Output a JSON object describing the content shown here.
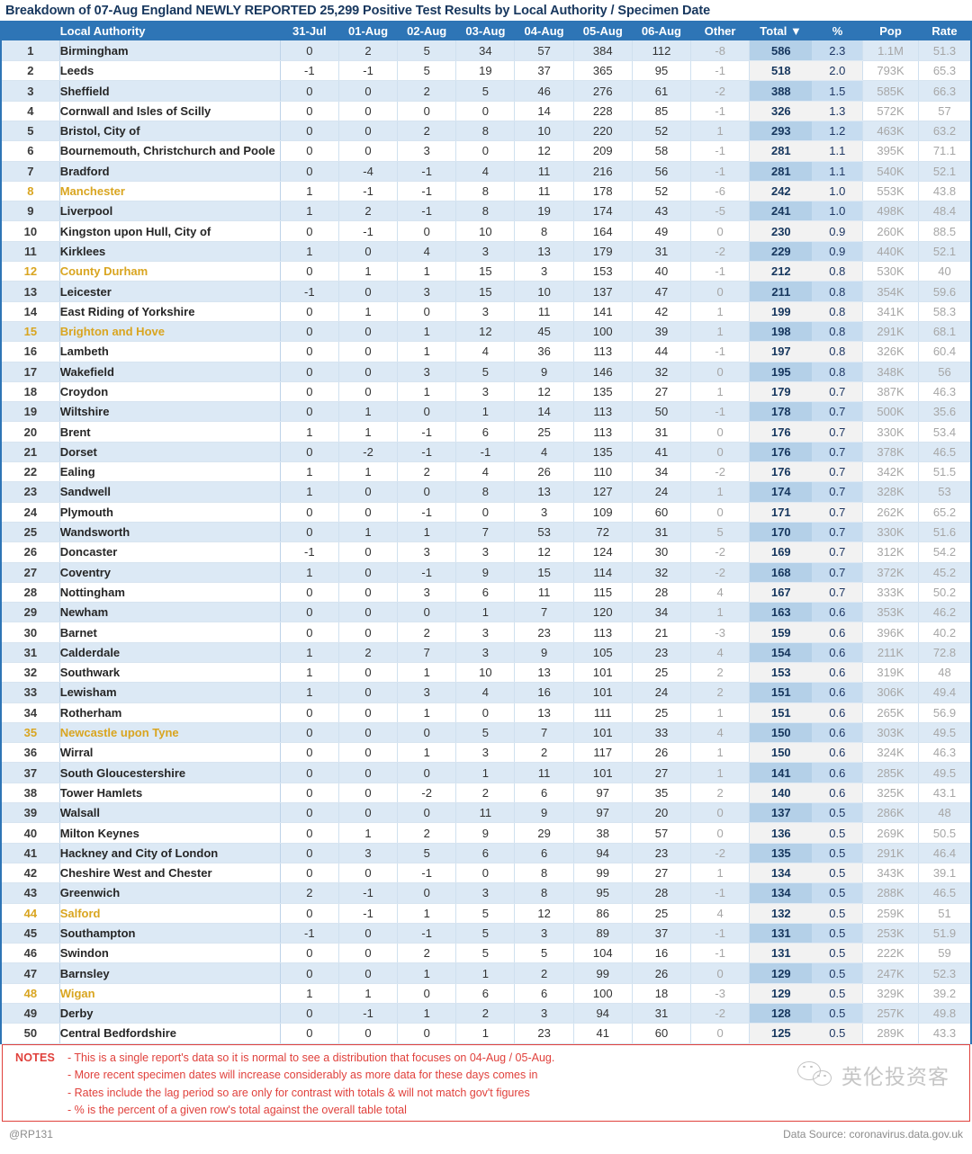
{
  "title": "Breakdown of 07-Aug England NEWLY REPORTED 25,299 Positive Test Results by Local Authority / Specimen Date",
  "table": {
    "headers": {
      "rank": "",
      "authority": "Local Authority",
      "days": [
        "31-Jul",
        "01-Aug",
        "02-Aug",
        "03-Aug",
        "04-Aug",
        "05-Aug",
        "06-Aug"
      ],
      "other": "Other",
      "total": "Total ▼",
      "percent": "%",
      "pop": "Pop",
      "rate": "Rate"
    },
    "sort_indicator": "▼",
    "rows": [
      {
        "rank": "1",
        "authority": "Birmingham",
        "days": [
          "0",
          "2",
          "5",
          "34",
          "57",
          "384",
          "112"
        ],
        "other": "-8",
        "total": "586",
        "percent": "2.3",
        "pop": "1.1M",
        "rate": "51.3",
        "highlight": false
      },
      {
        "rank": "2",
        "authority": "Leeds",
        "days": [
          "-1",
          "-1",
          "5",
          "19",
          "37",
          "365",
          "95"
        ],
        "other": "-1",
        "total": "518",
        "percent": "2.0",
        "pop": "793K",
        "rate": "65.3",
        "highlight": false
      },
      {
        "rank": "3",
        "authority": "Sheffield",
        "days": [
          "0",
          "0",
          "2",
          "5",
          "46",
          "276",
          "61"
        ],
        "other": "-2",
        "total": "388",
        "percent": "1.5",
        "pop": "585K",
        "rate": "66.3",
        "highlight": false
      },
      {
        "rank": "4",
        "authority": "Cornwall and Isles of Scilly",
        "days": [
          "0",
          "0",
          "0",
          "0",
          "14",
          "228",
          "85"
        ],
        "other": "-1",
        "total": "326",
        "percent": "1.3",
        "pop": "572K",
        "rate": "57",
        "highlight": false
      },
      {
        "rank": "5",
        "authority": "Bristol, City of",
        "days": [
          "0",
          "0",
          "2",
          "8",
          "10",
          "220",
          "52"
        ],
        "other": "1",
        "total": "293",
        "percent": "1.2",
        "pop": "463K",
        "rate": "63.2",
        "highlight": false
      },
      {
        "rank": "6",
        "authority": "Bournemouth, Christchurch and Poole",
        "days": [
          "0",
          "0",
          "3",
          "0",
          "12",
          "209",
          "58"
        ],
        "other": "-1",
        "total": "281",
        "percent": "1.1",
        "pop": "395K",
        "rate": "71.1",
        "highlight": false
      },
      {
        "rank": "7",
        "authority": "Bradford",
        "days": [
          "0",
          "-4",
          "-1",
          "4",
          "11",
          "216",
          "56"
        ],
        "other": "-1",
        "total": "281",
        "percent": "1.1",
        "pop": "540K",
        "rate": "52.1",
        "highlight": false
      },
      {
        "rank": "8",
        "authority": "Manchester",
        "days": [
          "1",
          "-1",
          "-1",
          "8",
          "11",
          "178",
          "52"
        ],
        "other": "-6",
        "total": "242",
        "percent": "1.0",
        "pop": "553K",
        "rate": "43.8",
        "highlight": true
      },
      {
        "rank": "9",
        "authority": "Liverpool",
        "days": [
          "1",
          "2",
          "-1",
          "8",
          "19",
          "174",
          "43"
        ],
        "other": "-5",
        "total": "241",
        "percent": "1.0",
        "pop": "498K",
        "rate": "48.4",
        "highlight": false
      },
      {
        "rank": "10",
        "authority": "Kingston upon Hull, City of",
        "days": [
          "0",
          "-1",
          "0",
          "10",
          "8",
          "164",
          "49"
        ],
        "other": "0",
        "total": "230",
        "percent": "0.9",
        "pop": "260K",
        "rate": "88.5",
        "highlight": false
      },
      {
        "rank": "11",
        "authority": "Kirklees",
        "days": [
          "1",
          "0",
          "4",
          "3",
          "13",
          "179",
          "31"
        ],
        "other": "-2",
        "total": "229",
        "percent": "0.9",
        "pop": "440K",
        "rate": "52.1",
        "highlight": false
      },
      {
        "rank": "12",
        "authority": "County Durham",
        "days": [
          "0",
          "1",
          "1",
          "15",
          "3",
          "153",
          "40"
        ],
        "other": "-1",
        "total": "212",
        "percent": "0.8",
        "pop": "530K",
        "rate": "40",
        "highlight": true
      },
      {
        "rank": "13",
        "authority": "Leicester",
        "days": [
          "-1",
          "0",
          "3",
          "15",
          "10",
          "137",
          "47"
        ],
        "other": "0",
        "total": "211",
        "percent": "0.8",
        "pop": "354K",
        "rate": "59.6",
        "highlight": false
      },
      {
        "rank": "14",
        "authority": "East Riding of Yorkshire",
        "days": [
          "0",
          "1",
          "0",
          "3",
          "11",
          "141",
          "42"
        ],
        "other": "1",
        "total": "199",
        "percent": "0.8",
        "pop": "341K",
        "rate": "58.3",
        "highlight": false
      },
      {
        "rank": "15",
        "authority": "Brighton and Hove",
        "days": [
          "0",
          "0",
          "1",
          "12",
          "45",
          "100",
          "39"
        ],
        "other": "1",
        "total": "198",
        "percent": "0.8",
        "pop": "291K",
        "rate": "68.1",
        "highlight": true
      },
      {
        "rank": "16",
        "authority": "Lambeth",
        "days": [
          "0",
          "0",
          "1",
          "4",
          "36",
          "113",
          "44"
        ],
        "other": "-1",
        "total": "197",
        "percent": "0.8",
        "pop": "326K",
        "rate": "60.4",
        "highlight": false
      },
      {
        "rank": "17",
        "authority": "Wakefield",
        "days": [
          "0",
          "0",
          "3",
          "5",
          "9",
          "146",
          "32"
        ],
        "other": "0",
        "total": "195",
        "percent": "0.8",
        "pop": "348K",
        "rate": "56",
        "highlight": false
      },
      {
        "rank": "18",
        "authority": "Croydon",
        "days": [
          "0",
          "0",
          "1",
          "3",
          "12",
          "135",
          "27"
        ],
        "other": "1",
        "total": "179",
        "percent": "0.7",
        "pop": "387K",
        "rate": "46.3",
        "highlight": false
      },
      {
        "rank": "19",
        "authority": "Wiltshire",
        "days": [
          "0",
          "1",
          "0",
          "1",
          "14",
          "113",
          "50"
        ],
        "other": "-1",
        "total": "178",
        "percent": "0.7",
        "pop": "500K",
        "rate": "35.6",
        "highlight": false
      },
      {
        "rank": "20",
        "authority": "Brent",
        "days": [
          "1",
          "1",
          "-1",
          "6",
          "25",
          "113",
          "31"
        ],
        "other": "0",
        "total": "176",
        "percent": "0.7",
        "pop": "330K",
        "rate": "53.4",
        "highlight": false
      },
      {
        "rank": "21",
        "authority": "Dorset",
        "days": [
          "0",
          "-2",
          "-1",
          "-1",
          "4",
          "135",
          "41"
        ],
        "other": "0",
        "total": "176",
        "percent": "0.7",
        "pop": "378K",
        "rate": "46.5",
        "highlight": false
      },
      {
        "rank": "22",
        "authority": "Ealing",
        "days": [
          "1",
          "1",
          "2",
          "4",
          "26",
          "110",
          "34"
        ],
        "other": "-2",
        "total": "176",
        "percent": "0.7",
        "pop": "342K",
        "rate": "51.5",
        "highlight": false
      },
      {
        "rank": "23",
        "authority": "Sandwell",
        "days": [
          "1",
          "0",
          "0",
          "8",
          "13",
          "127",
          "24"
        ],
        "other": "1",
        "total": "174",
        "percent": "0.7",
        "pop": "328K",
        "rate": "53",
        "highlight": false
      },
      {
        "rank": "24",
        "authority": "Plymouth",
        "days": [
          "0",
          "0",
          "-1",
          "0",
          "3",
          "109",
          "60"
        ],
        "other": "0",
        "total": "171",
        "percent": "0.7",
        "pop": "262K",
        "rate": "65.2",
        "highlight": false
      },
      {
        "rank": "25",
        "authority": "Wandsworth",
        "days": [
          "0",
          "1",
          "1",
          "7",
          "53",
          "72",
          "31"
        ],
        "other": "5",
        "total": "170",
        "percent": "0.7",
        "pop": "330K",
        "rate": "51.6",
        "highlight": false
      },
      {
        "rank": "26",
        "authority": "Doncaster",
        "days": [
          "-1",
          "0",
          "3",
          "3",
          "12",
          "124",
          "30"
        ],
        "other": "-2",
        "total": "169",
        "percent": "0.7",
        "pop": "312K",
        "rate": "54.2",
        "highlight": false
      },
      {
        "rank": "27",
        "authority": "Coventry",
        "days": [
          "1",
          "0",
          "-1",
          "9",
          "15",
          "114",
          "32"
        ],
        "other": "-2",
        "total": "168",
        "percent": "0.7",
        "pop": "372K",
        "rate": "45.2",
        "highlight": false
      },
      {
        "rank": "28",
        "authority": "Nottingham",
        "days": [
          "0",
          "0",
          "3",
          "6",
          "11",
          "115",
          "28"
        ],
        "other": "4",
        "total": "167",
        "percent": "0.7",
        "pop": "333K",
        "rate": "50.2",
        "highlight": false
      },
      {
        "rank": "29",
        "authority": "Newham",
        "days": [
          "0",
          "0",
          "0",
          "1",
          "7",
          "120",
          "34"
        ],
        "other": "1",
        "total": "163",
        "percent": "0.6",
        "pop": "353K",
        "rate": "46.2",
        "highlight": false
      },
      {
        "rank": "30",
        "authority": "Barnet",
        "days": [
          "0",
          "0",
          "2",
          "3",
          "23",
          "113",
          "21"
        ],
        "other": "-3",
        "total": "159",
        "percent": "0.6",
        "pop": "396K",
        "rate": "40.2",
        "highlight": false
      },
      {
        "rank": "31",
        "authority": "Calderdale",
        "days": [
          "1",
          "2",
          "7",
          "3",
          "9",
          "105",
          "23"
        ],
        "other": "4",
        "total": "154",
        "percent": "0.6",
        "pop": "211K",
        "rate": "72.8",
        "highlight": false
      },
      {
        "rank": "32",
        "authority": "Southwark",
        "days": [
          "1",
          "0",
          "1",
          "10",
          "13",
          "101",
          "25"
        ],
        "other": "2",
        "total": "153",
        "percent": "0.6",
        "pop": "319K",
        "rate": "48",
        "highlight": false
      },
      {
        "rank": "33",
        "authority": "Lewisham",
        "days": [
          "1",
          "0",
          "3",
          "4",
          "16",
          "101",
          "24"
        ],
        "other": "2",
        "total": "151",
        "percent": "0.6",
        "pop": "306K",
        "rate": "49.4",
        "highlight": false
      },
      {
        "rank": "34",
        "authority": "Rotherham",
        "days": [
          "0",
          "0",
          "1",
          "0",
          "13",
          "111",
          "25"
        ],
        "other": "1",
        "total": "151",
        "percent": "0.6",
        "pop": "265K",
        "rate": "56.9",
        "highlight": false
      },
      {
        "rank": "35",
        "authority": "Newcastle upon Tyne",
        "days": [
          "0",
          "0",
          "0",
          "5",
          "7",
          "101",
          "33"
        ],
        "other": "4",
        "total": "150",
        "percent": "0.6",
        "pop": "303K",
        "rate": "49.5",
        "highlight": true
      },
      {
        "rank": "36",
        "authority": "Wirral",
        "days": [
          "0",
          "0",
          "1",
          "3",
          "2",
          "117",
          "26"
        ],
        "other": "1",
        "total": "150",
        "percent": "0.6",
        "pop": "324K",
        "rate": "46.3",
        "highlight": false
      },
      {
        "rank": "37",
        "authority": "South Gloucestershire",
        "days": [
          "0",
          "0",
          "0",
          "1",
          "11",
          "101",
          "27"
        ],
        "other": "1",
        "total": "141",
        "percent": "0.6",
        "pop": "285K",
        "rate": "49.5",
        "highlight": false
      },
      {
        "rank": "38",
        "authority": "Tower Hamlets",
        "days": [
          "0",
          "0",
          "-2",
          "2",
          "6",
          "97",
          "35"
        ],
        "other": "2",
        "total": "140",
        "percent": "0.6",
        "pop": "325K",
        "rate": "43.1",
        "highlight": false
      },
      {
        "rank": "39",
        "authority": "Walsall",
        "days": [
          "0",
          "0",
          "0",
          "11",
          "9",
          "97",
          "20"
        ],
        "other": "0",
        "total": "137",
        "percent": "0.5",
        "pop": "286K",
        "rate": "48",
        "highlight": false
      },
      {
        "rank": "40",
        "authority": "Milton Keynes",
        "days": [
          "0",
          "1",
          "2",
          "9",
          "29",
          "38",
          "57"
        ],
        "other": "0",
        "total": "136",
        "percent": "0.5",
        "pop": "269K",
        "rate": "50.5",
        "highlight": false
      },
      {
        "rank": "41",
        "authority": "Hackney and City of London",
        "days": [
          "0",
          "3",
          "5",
          "6",
          "6",
          "94",
          "23"
        ],
        "other": "-2",
        "total": "135",
        "percent": "0.5",
        "pop": "291K",
        "rate": "46.4",
        "highlight": false
      },
      {
        "rank": "42",
        "authority": "Cheshire West and Chester",
        "days": [
          "0",
          "0",
          "-1",
          "0",
          "8",
          "99",
          "27"
        ],
        "other": "1",
        "total": "134",
        "percent": "0.5",
        "pop": "343K",
        "rate": "39.1",
        "highlight": false
      },
      {
        "rank": "43",
        "authority": "Greenwich",
        "days": [
          "2",
          "-1",
          "0",
          "3",
          "8",
          "95",
          "28"
        ],
        "other": "-1",
        "total": "134",
        "percent": "0.5",
        "pop": "288K",
        "rate": "46.5",
        "highlight": false
      },
      {
        "rank": "44",
        "authority": "Salford",
        "days": [
          "0",
          "-1",
          "1",
          "5",
          "12",
          "86",
          "25"
        ],
        "other": "4",
        "total": "132",
        "percent": "0.5",
        "pop": "259K",
        "rate": "51",
        "highlight": true
      },
      {
        "rank": "45",
        "authority": "Southampton",
        "days": [
          "-1",
          "0",
          "-1",
          "5",
          "3",
          "89",
          "37"
        ],
        "other": "-1",
        "total": "131",
        "percent": "0.5",
        "pop": "253K",
        "rate": "51.9",
        "highlight": false
      },
      {
        "rank": "46",
        "authority": "Swindon",
        "days": [
          "0",
          "0",
          "2",
          "5",
          "5",
          "104",
          "16"
        ],
        "other": "-1",
        "total": "131",
        "percent": "0.5",
        "pop": "222K",
        "rate": "59",
        "highlight": false
      },
      {
        "rank": "47",
        "authority": "Barnsley",
        "days": [
          "0",
          "0",
          "1",
          "1",
          "2",
          "99",
          "26"
        ],
        "other": "0",
        "total": "129",
        "percent": "0.5",
        "pop": "247K",
        "rate": "52.3",
        "highlight": false
      },
      {
        "rank": "48",
        "authority": "Wigan",
        "days": [
          "1",
          "1",
          "0",
          "6",
          "6",
          "100",
          "18"
        ],
        "other": "-3",
        "total": "129",
        "percent": "0.5",
        "pop": "329K",
        "rate": "39.2",
        "highlight": true
      },
      {
        "rank": "49",
        "authority": "Derby",
        "days": [
          "0",
          "-1",
          "1",
          "2",
          "3",
          "94",
          "31"
        ],
        "other": "-2",
        "total": "128",
        "percent": "0.5",
        "pop": "257K",
        "rate": "49.8",
        "highlight": false
      },
      {
        "rank": "50",
        "authority": "Central Bedfordshire",
        "days": [
          "0",
          "0",
          "0",
          "1",
          "23",
          "41",
          "60"
        ],
        "other": "0",
        "total": "125",
        "percent": "0.5",
        "pop": "289K",
        "rate": "43.3",
        "highlight": false
      }
    ]
  },
  "notes": {
    "label": "NOTES",
    "lines": [
      "- This is a single report's data so it is normal to see a distribution that focuses on 04-Aug / 05-Aug.",
      "- More recent specimen dates will increase considerably as more data for these days comes in",
      "- Rates include the lag period so are only for contrast with totals & will not match gov't figures",
      "- % is the percent of a given row's total against the overall table total"
    ]
  },
  "watermark": {
    "text": "英伦投资客"
  },
  "footer": {
    "author": "@RP131",
    "source": "Data Source: coronavirus.data.gov.uk"
  },
  "colors": {
    "header_blue": "#2e75b6",
    "title_blue": "#17375e",
    "stripe_blue": "#dce9f5",
    "total_blue": "#b4d0e8",
    "highlight_gold": "#d9a520",
    "notes_red": "#e0413c"
  }
}
